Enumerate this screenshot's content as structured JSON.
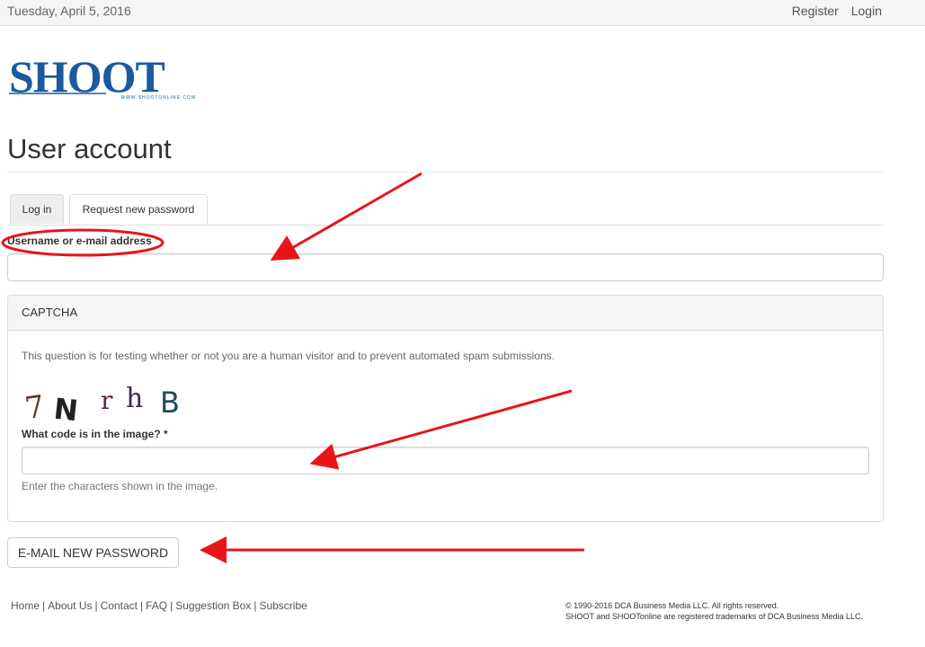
{
  "topbar": {
    "date": "Tuesday, April 5, 2016",
    "register_label": "Register",
    "login_label": "Login"
  },
  "logo": {
    "wordmark": "SHOOT",
    "url_text": "WWW.SHOOTONLINE.COM"
  },
  "page": {
    "title": "User account"
  },
  "tabs": [
    {
      "label": "Log in",
      "active": false
    },
    {
      "label": "Request new password",
      "active": true
    }
  ],
  "form": {
    "username_label": "Username or e-mail address",
    "required_marker": "*",
    "username_value": "",
    "submit_label": "E-MAIL NEW PASSWORD"
  },
  "captcha": {
    "heading": "CAPTCHA",
    "description": "This question is for testing whether or not you are a human visitor and to prevent automated spam submissions.",
    "image_chars": [
      "7",
      "N",
      "r",
      "h",
      "B"
    ],
    "question_label": "What code is in the image?",
    "required_marker": "*",
    "value": "",
    "help": "Enter the characters shown in the image."
  },
  "footer": {
    "links": [
      "Home",
      "About Us",
      "Contact",
      "FAQ",
      "Suggestion Box",
      "Subscribe"
    ],
    "separator": "|",
    "copyright_line1": "© 1990-2016 DCA Business Media LLC. All rights reserved.",
    "copyright_line2": "SHOOT and SHOOTonline are registered trademarks of DCA Business Media LLC."
  },
  "colors": {
    "brand_blue": "#1c5a9e",
    "annotation_red": "#e8141b"
  }
}
